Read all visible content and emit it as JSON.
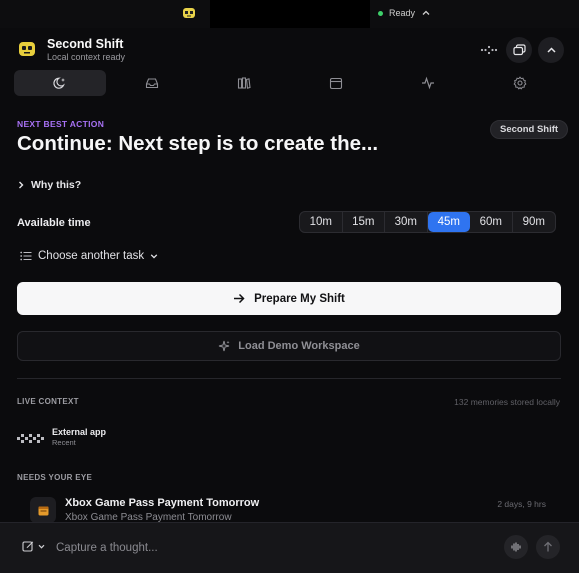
{
  "system": {
    "status_text": "Ready",
    "status_color": "#3ecf6a"
  },
  "app": {
    "title": "Second Shift",
    "subtitle": "Local context ready",
    "accent": "#2f74f0",
    "label_accent": "#a872f5"
  },
  "tabs": [
    {
      "icon": "moon-sparkle-icon",
      "active": true
    },
    {
      "icon": "inbox-icon",
      "active": false
    },
    {
      "icon": "library-icon",
      "active": false
    },
    {
      "icon": "calendar-icon",
      "active": false
    },
    {
      "icon": "activity-icon",
      "active": false
    },
    {
      "icon": "gear-icon",
      "active": false
    }
  ],
  "next_action": {
    "label": "NEXT BEST ACTION",
    "badge": "Second Shift",
    "title": "Continue: Next step is to create the...",
    "why": "Why this?"
  },
  "available_time": {
    "label": "Available time",
    "options": [
      "10m",
      "15m",
      "30m",
      "45m",
      "60m",
      "90m"
    ],
    "selected": "45m"
  },
  "choose_task": {
    "label": "Choose another task"
  },
  "buttons": {
    "primary": "Prepare My Shift",
    "secondary": "Load Demo Workspace"
  },
  "live_context": {
    "label": "LIVE CONTEXT",
    "memories": "132 memories stored locally",
    "item": {
      "name": "External app",
      "sub": "Recent"
    }
  },
  "needs_eye": {
    "label": "NEEDS YOUR EYE",
    "task": {
      "title": "Xbox Game Pass Payment Tomorrow",
      "subtitle": "Xbox Game Pass Payment Tomorrow",
      "time": "2 days, 9 hrs"
    }
  },
  "composer": {
    "placeholder": "Capture a thought..."
  }
}
